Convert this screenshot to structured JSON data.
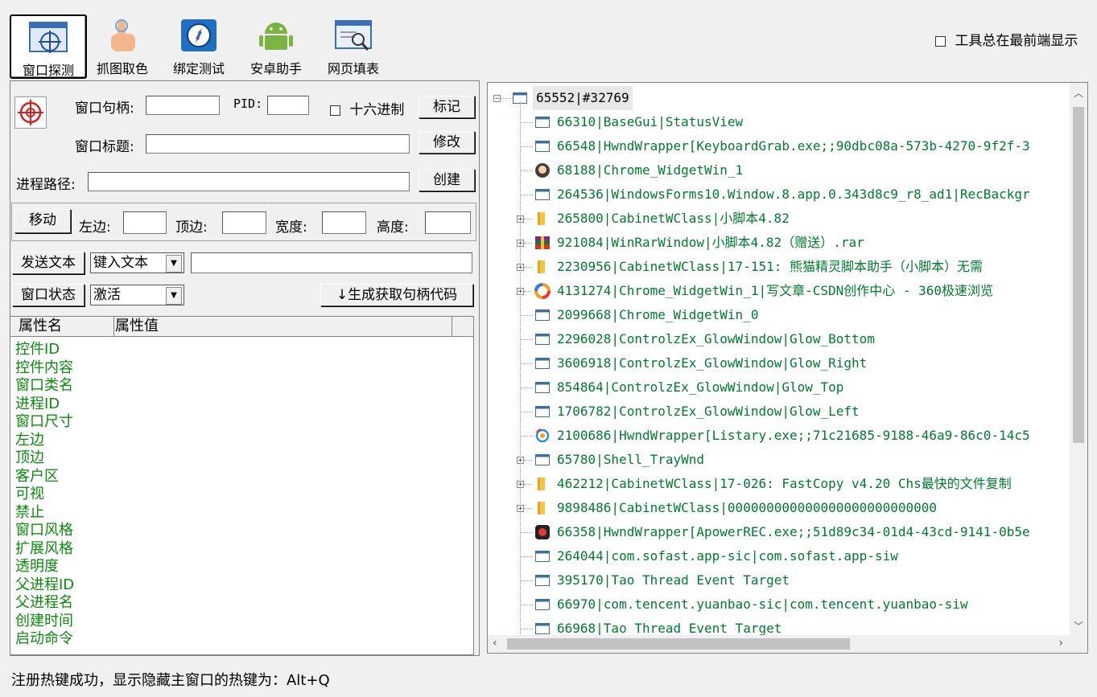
{
  "toolbar": {
    "items": [
      {
        "label": "窗口探测",
        "icon": "window-probe-icon"
      },
      {
        "label": "抓图取色",
        "icon": "hand-pointer-icon"
      },
      {
        "label": "绑定测试",
        "icon": "compass-icon"
      },
      {
        "label": "安卓助手",
        "icon": "android-icon"
      },
      {
        "label": "网页填表",
        "icon": "web-form-icon"
      }
    ],
    "always_on_top_label": "工具总在最前端显示"
  },
  "form": {
    "handle_label": "窗口句柄:",
    "handle_value": "",
    "pid_label": "PID:",
    "pid_value": "",
    "hex_label": "十六进制",
    "mark_button": "标记",
    "title_label": "窗口标题:",
    "title_value": "",
    "modify_button": "修改",
    "path_label": "进程路径:",
    "path_value": "",
    "create_button": "创建",
    "move_button": "移动",
    "left_label": "左边:",
    "top_label": "顶边:",
    "width_label": "宽度:",
    "height_label": "高度:",
    "send_text_button": "发送文本",
    "send_mode": "键入文本",
    "send_text_value": "",
    "window_state_button": "窗口状态",
    "window_state": "激活",
    "gen_code_button": "↓生成获取句柄代码"
  },
  "properties": {
    "col_name": "属性名",
    "col_value": "属性值",
    "rows": [
      "控件ID",
      "控件内容",
      "窗口类名",
      "进程ID",
      "窗口尺寸",
      "左边",
      "顶边",
      "客户区",
      "可视",
      "禁止",
      "窗口风格",
      "扩展风格",
      "透明度",
      "父进程ID",
      "父进程名",
      "创建时间",
      "启动命令"
    ]
  },
  "tree": {
    "root": "65552|#32769",
    "items": [
      {
        "text": "66310|BaseGui|StatusView",
        "icon": "window",
        "expand": false
      },
      {
        "text": "66548|HwndWrapper[KeyboardGrab.exe;;90dbc08a-573b-4270-9f2f-3",
        "icon": "window",
        "expand": false
      },
      {
        "text": "68188|Chrome_WidgetWin_1",
        "icon": "avatar",
        "expand": false
      },
      {
        "text": "264536|WindowsForms10.Window.8.app.0.343d8c9_r8_ad1|RecBackgr",
        "icon": "window",
        "expand": false
      },
      {
        "text": "265800|CabinetWClass|小脚本4.82",
        "icon": "folder",
        "expand": true
      },
      {
        "text": "921084|WinRarWindow|小脚本4.82（赠送）.rar",
        "icon": "winrar",
        "expand": true
      },
      {
        "text": "2230956|CabinetWClass|17-151: 熊猫精灵脚本助手（小脚本）无需",
        "icon": "folder",
        "expand": true
      },
      {
        "text": "4131274|Chrome_WidgetWin_1|写文章-CSDN创作中心 - 360极速浏览",
        "icon": "browser360",
        "expand": true
      },
      {
        "text": "2099668|Chrome_WidgetWin_0",
        "icon": "window",
        "expand": false
      },
      {
        "text": "2296028|ControlzEx_GlowWindow|Glow_Bottom",
        "icon": "window",
        "expand": false
      },
      {
        "text": "3606918|ControlzEx_GlowWindow|Glow_Right",
        "icon": "window",
        "expand": false
      },
      {
        "text": "854864|ControlzEx_GlowWindow|Glow_Top",
        "icon": "window",
        "expand": false
      },
      {
        "text": "1706782|ControlzEx_GlowWindow|Glow_Left",
        "icon": "window",
        "expand": false
      },
      {
        "text": "2100686|HwndWrapper[Listary.exe;;71c21685-9188-46a9-86c0-14c5",
        "icon": "listary",
        "expand": false
      },
      {
        "text": "65780|Shell_TrayWnd",
        "icon": "window",
        "expand": true
      },
      {
        "text": "462212|CabinetWClass|17-026: FastCopy v4.20 Chs最快的文件复制",
        "icon": "folder",
        "expand": true
      },
      {
        "text": "9898486|CabinetWClass|000000000000000000000000000",
        "icon": "folder",
        "expand": true
      },
      {
        "text": "66358|HwndWrapper[ApowerREC.exe;;51d89c34-01d4-43cd-9141-0b5e",
        "icon": "apowerrec",
        "expand": false
      },
      {
        "text": "264044|com.sofast.app-sic|com.sofast.app-siw",
        "icon": "window",
        "expand": false
      },
      {
        "text": "395170|Tao Thread Event Target",
        "icon": "window",
        "expand": false
      },
      {
        "text": "66970|com.tencent.yuanbao-sic|com.tencent.yuanbao-siw",
        "icon": "window",
        "expand": false
      },
      {
        "text": "66968|Tao Thread Event Target",
        "icon": "window",
        "expand": false
      }
    ]
  },
  "status_bar": "注册热键成功，显示隐藏主窗口的热键为：Alt+Q"
}
